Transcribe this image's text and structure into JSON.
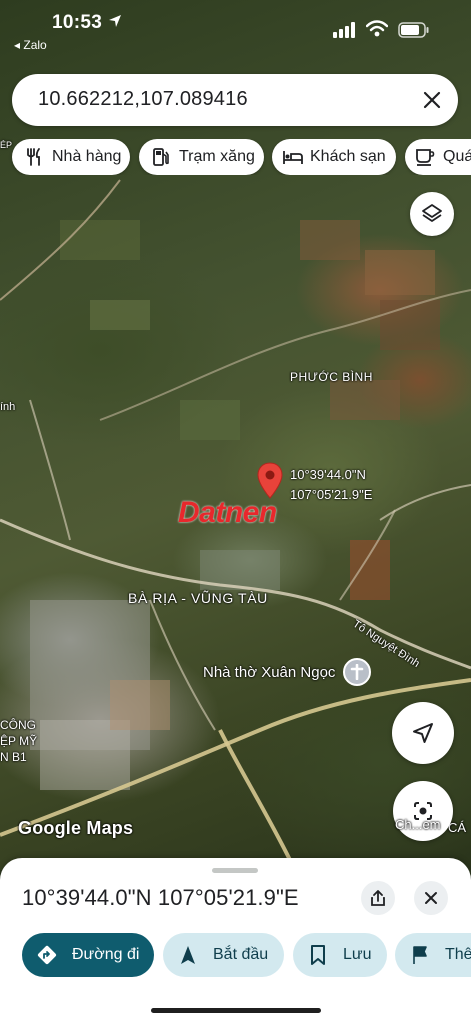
{
  "status_bar": {
    "time": "10:53",
    "back_app": "◂ Zalo"
  },
  "search": {
    "value": "10.662212,107.089416"
  },
  "chips": [
    {
      "label": "Nhà hàng",
      "icon": "restaurant-icon"
    },
    {
      "label": "Trạm xăng",
      "icon": "gas-station-icon"
    },
    {
      "label": "Khách sạn",
      "icon": "hotel-icon"
    },
    {
      "label": "Quán",
      "icon": "cafe-icon"
    }
  ],
  "map": {
    "place_label": "PHƯỚC BÌNH",
    "pin_coord_lat": "10°39'44.0\"N",
    "pin_coord_lng": "107°05'21.9\"E",
    "province": "BÀ RỊA - VŨNG TÀU",
    "road": "Tô Nguyệt Đình",
    "church": "Nhà thờ Xuân Ngọc",
    "industrial_1": "CÔNG",
    "industrial_2": "ỆP MỸ",
    "industrial_3": "N B1",
    "edge_left": "ính",
    "edge_ep": "ÉP",
    "edge_right": "CÁ",
    "lens_label": "Ch...em",
    "brand": "Google Maps",
    "watermark": "Datnen"
  },
  "sheet": {
    "title": "10°39'44.0\"N 107°05'21.9\"E"
  },
  "actions": [
    {
      "label": "Đường đi",
      "icon": "directions-icon"
    },
    {
      "label": "Bắt đầu",
      "icon": "navigation-arrow-icon"
    },
    {
      "label": "Lưu",
      "icon": "bookmark-icon"
    },
    {
      "label": "Thê",
      "icon": "flag-icon"
    }
  ],
  "colors": {
    "primary_action": "#0f5c6e",
    "secondary_action": "#d3e9ef",
    "pin": "#e8433a"
  }
}
